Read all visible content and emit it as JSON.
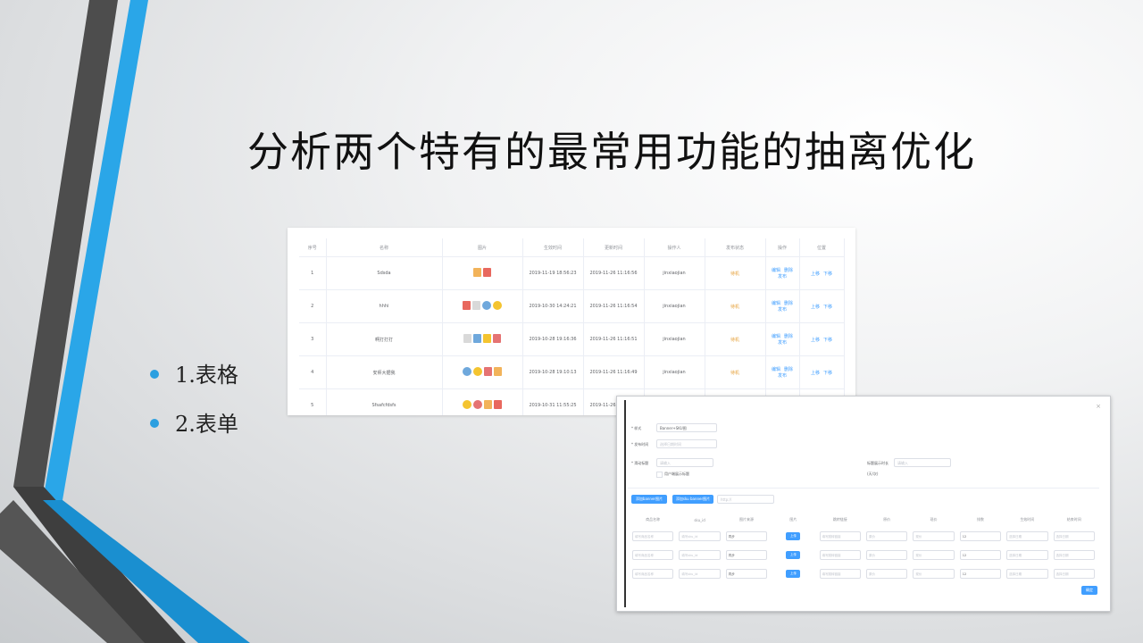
{
  "slide": {
    "title": "分析两个特有的最常用功能的抽离优化",
    "bullets": [
      "1.表格",
      "2.表单"
    ]
  },
  "colors": {
    "accent_blue": "#2b9fe0",
    "dark_gray": "#4a4a4a",
    "primary_button": "#409eff",
    "status_orange": "#e6a23c"
  },
  "table_screenshot": {
    "headers": [
      "序号",
      "名称",
      "图片",
      "生效时间",
      "更新时间",
      "操作人",
      "发布状态",
      "操作",
      "位置"
    ],
    "rows": [
      {
        "index": "1",
        "name": "Sdsda",
        "created": "2019-11-19 18:56:23",
        "updated": "2019-11-26 11:16:56",
        "operator": "jinxiaojian",
        "status": "待机",
        "thumbs": 2
      },
      {
        "index": "2",
        "name": "hhhi",
        "created": "2019-10-30 14:24:21",
        "updated": "2019-11-26 11:16:54",
        "operator": "jinxiaojian",
        "status": "待机",
        "thumbs": 4
      },
      {
        "index": "3",
        "name": "啊打打打",
        "created": "2019-10-28 19:16:36",
        "updated": "2019-11-26 11:16:51",
        "operator": "jinxiaojian",
        "status": "待机",
        "thumbs": 4
      },
      {
        "index": "4",
        "name": "安师大据我",
        "created": "2019-10-28 19:10:13",
        "updated": "2019-11-26 11:16:49",
        "operator": "jinxiaojian",
        "status": "待机",
        "thumbs": 4
      },
      {
        "index": "5",
        "name": "Sfsafcfdsfs",
        "created": "2019-10-31 11:55:25",
        "updated": "2019-11-26 11:16:47",
        "operator": "jinxiaojian",
        "status": "待机",
        "thumbs": 4
      }
    ],
    "action_labels": {
      "edit": "编辑",
      "delete": "删除",
      "publish": "发布",
      "up": "上移",
      "down": "下移"
    }
  },
  "form_screenshot": {
    "close_glyph": "×",
    "style_label": "* 样式",
    "style_value": "Banner+SKU图",
    "time_label": "* 发布时间",
    "time_placeholder": "选择日期时间",
    "title_label": "* 滑动标题",
    "title_placeholder": "请输入",
    "right_label": "标题展示时长",
    "right_placeholder": "请输入",
    "right_unit": "(天/次)",
    "checkbox_label": "用户端展示标题",
    "btn_add_banner": "添加banner图片",
    "btn_add_sku": "添加sku banner图片",
    "url_placeholder": "http://",
    "sku_headers": [
      "商品名称",
      "sku_id",
      "图片来源",
      "图片",
      "跳转链接",
      "原价",
      "现价",
      "排数",
      "生效时间",
      "结束时间"
    ],
    "sku_row": {
      "name_ph": "填写商品名称",
      "sku_ph": "填写sku_id",
      "source": "同步",
      "upload": "上传",
      "link_ph": "填写跳转链接",
      "price_ph": "原价",
      "price2_ph": "现价",
      "rank": "12",
      "start_ph": "选择日期",
      "end_ph": "选择日期"
    },
    "submit_label": "确定"
  }
}
